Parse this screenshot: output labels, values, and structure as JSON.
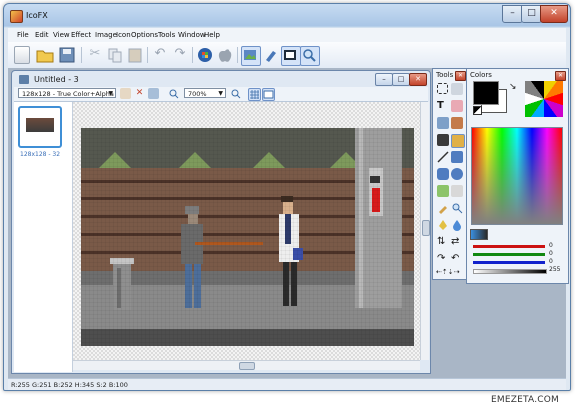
{
  "app": {
    "title": "IcoFX"
  },
  "menu": [
    "File",
    "Edit",
    "View",
    "Effect",
    "Image",
    "Icon",
    "Options",
    "Tools",
    "Window",
    "Help"
  ],
  "document": {
    "title": "Untitled - 3",
    "format": "128x128 - True Color+Alpha",
    "zoom": "700%",
    "thumb_label": "128x128 - 32"
  },
  "panels": {
    "tools_title": "Tools",
    "colors_title": "Colors",
    "rgb_values": [
      "0",
      "0",
      "0"
    ],
    "alpha_value": "255"
  },
  "status": {
    "text": "R:255 G:251 B:252   H:345 S:2 B:100"
  },
  "watermark": "EMEZETA.COM",
  "colors": {
    "accent": "#3f8fd6",
    "close": "#c3432b",
    "red_slider": "#cc1111",
    "green_slider": "#118811",
    "blue_slider": "#1122cc"
  }
}
